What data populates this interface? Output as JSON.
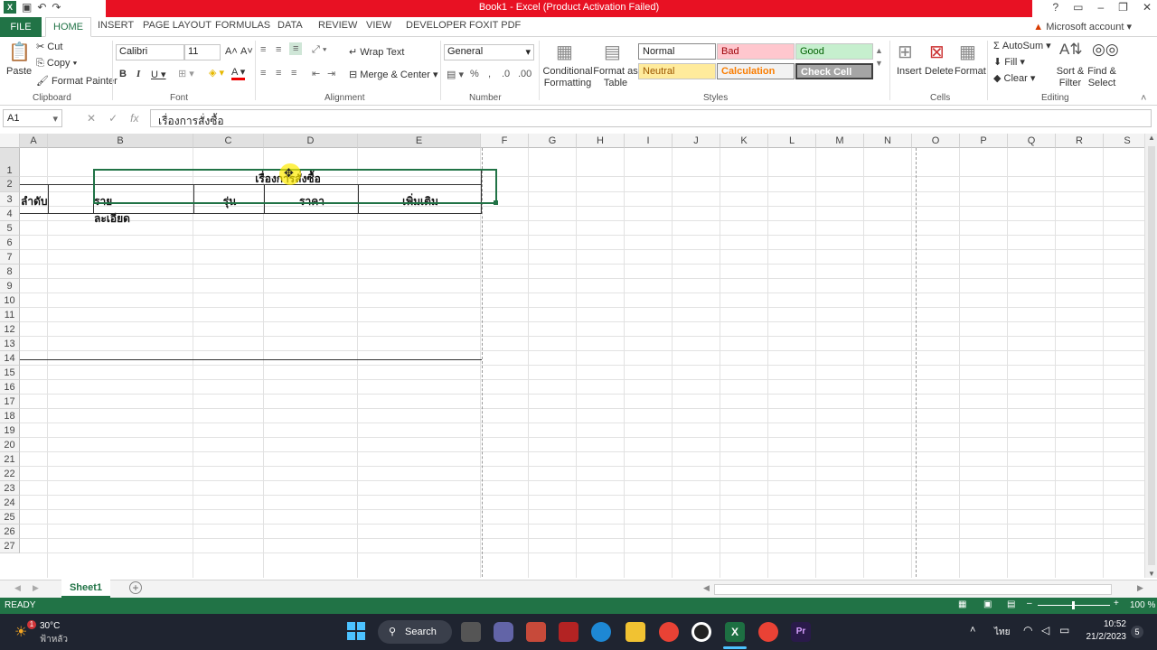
{
  "window": {
    "title": "Book1 - Excel (Product Activation Failed)",
    "account": "Microsoft account"
  },
  "tabs": [
    "FILE",
    "HOME",
    "INSERT",
    "PAGE LAYOUT",
    "FORMULAS",
    "DATA",
    "REVIEW",
    "VIEW",
    "DEVELOPER",
    "FOXIT PDF"
  ],
  "clipboard": {
    "paste": "Paste",
    "cut": "Cut",
    "copy": "Copy",
    "format_painter": "Format Painter",
    "label": "Clipboard"
  },
  "font": {
    "name": "Calibri",
    "size": "11",
    "label": "Font"
  },
  "alignment": {
    "wrap": "Wrap Text",
    "merge": "Merge & Center",
    "label": "Alignment"
  },
  "number": {
    "format": "General",
    "label": "Number"
  },
  "styles": {
    "conditional": "Conditional Formatting",
    "format_table": "Format as Table",
    "normal": "Normal",
    "bad": "Bad",
    "good": "Good",
    "neutral": "Neutral",
    "calculation": "Calculation",
    "check": "Check Cell",
    "label": "Styles"
  },
  "cells": {
    "insert": "Insert",
    "delete": "Delete",
    "format": "Format",
    "label": "Cells"
  },
  "editing": {
    "autosum": "AutoSum",
    "fill": "Fill",
    "clear": "Clear",
    "sort": "Sort & Filter",
    "find": "Find & Select",
    "label": "Editing"
  },
  "formula_bar": {
    "name_box": "A1",
    "fx": "fx",
    "value": "เรื่องการสั่งซื้อ"
  },
  "columns": [
    "A",
    "B",
    "C",
    "D",
    "E",
    "F",
    "G",
    "H",
    "I",
    "J",
    "K",
    "L",
    "M",
    "N",
    "O",
    "P",
    "Q",
    "R",
    "S"
  ],
  "rows": [
    "1",
    "2",
    "3",
    "4",
    "5",
    "6",
    "7",
    "8",
    "9",
    "10",
    "11",
    "12",
    "13",
    "14",
    "15",
    "16",
    "17",
    "18",
    "19",
    "20",
    "21",
    "22",
    "23",
    "24",
    "25",
    "26",
    "27"
  ],
  "sheet": {
    "title": "เรื่องการสั่งซื้อ",
    "headers": {
      "a": "ลำดับ",
      "b": "รายละเอียด",
      "c": "รุ่น",
      "d": "ราคา",
      "e": "เพิ่มเติม"
    }
  },
  "sheet_tab": "Sheet1",
  "status": {
    "ready": "READY",
    "zoom": "100 %"
  },
  "taskbar": {
    "weather_temp": "30°C",
    "weather_desc": "ฟ้าหลัว",
    "search": "Search",
    "lang": "ไทย",
    "time": "10:52",
    "date": "21/2/2023",
    "notif": "5"
  }
}
